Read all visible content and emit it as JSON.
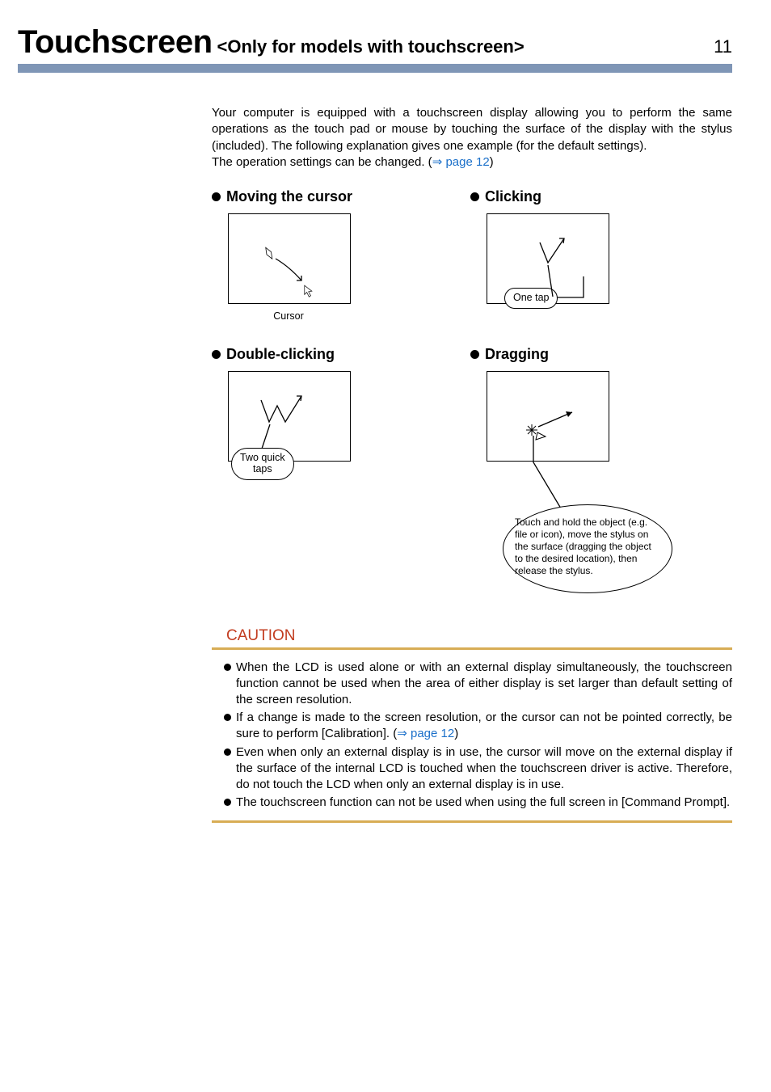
{
  "header": {
    "title_main": "Touchscreen",
    "title_sub": "<Only for models with touchscreen>",
    "page_number": "11"
  },
  "intro": {
    "p1": "Your computer is equipped with a touchscreen display allowing you to perform the same operations as the touch pad or mouse by touching the surface of the display with the stylus (included). The following explanation gives one example (for the default settings).",
    "p2_prefix": "The operation settings can be changed. (",
    "p2_link": "page 12",
    "p2_suffix": ")"
  },
  "sections": {
    "moving": {
      "title": "Moving the cursor",
      "caption": "Cursor"
    },
    "clicking": {
      "title": "Clicking",
      "label": "One tap"
    },
    "double": {
      "title": "Double-clicking",
      "label_l1": "Two quick",
      "label_l2": "taps"
    },
    "dragging": {
      "title": "Dragging",
      "callout": "Touch and hold the object (e.g. file or icon), move the stylus on the surface (dragging the object to the desired location), then release the stylus."
    }
  },
  "caution": {
    "heading": "CAUTION",
    "items": [
      {
        "text": "When the LCD is used alone or with an external display simultaneously, the touchscreen function cannot be used when the area of either display is set larger than default setting of the screen resolution."
      },
      {
        "text_prefix": "If a change is made to the screen resolution, or the cursor can not be pointed correctly, be sure to perform [Calibration]. (",
        "link": "page 12",
        "text_suffix": ")"
      },
      {
        "text": "Even when only an external display is in use, the cursor will move on the external display if the surface of the internal LCD is touched when the touchscreen driver is active. Therefore, do not touch the LCD when only an external display is in use."
      },
      {
        "text": "The touchscreen function can not be used when using the full screen in [Command Prompt]."
      }
    ]
  }
}
